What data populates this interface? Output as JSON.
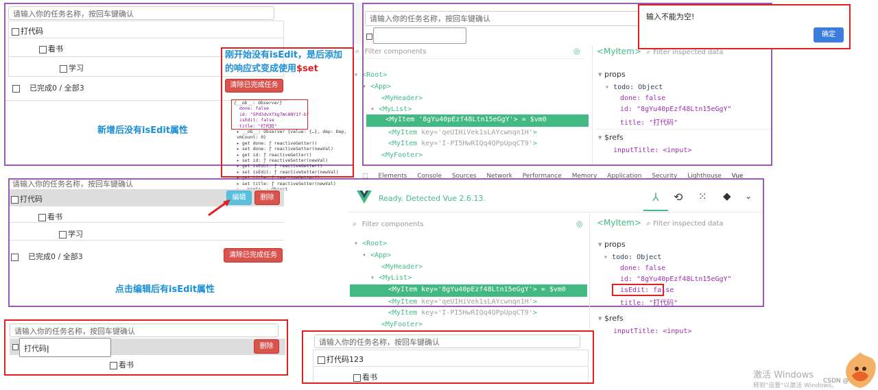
{
  "p1": {
    "input_placeholder": "请输入你的任务名称，按回车键确认",
    "items": [
      "打代码",
      "看书",
      "学习"
    ],
    "footer": "已完成0 / 全部3",
    "caption": "新增后没有isEdit属性"
  },
  "p2": {
    "note_line1": "刚开始没有isEdit，是后添加",
    "note_line2": "的响应式变成使用",
    "note_highlight": "$set",
    "clear_btn": "清除已完成任务",
    "console": [
      "{__ob__: Observer}",
      "done: false",
      "id: \"5Pd3dvXfXg7Wc8NY1f-b\"",
      "isEdit: false",
      "title: \"打代码\"",
      "▸ __ob__: Observer {value: {…}, dep: Dep, vmCount: 0}",
      "▸ get done: ƒ reactiveGetter()",
      "▸ set done: ƒ reactiveSetter(newVal)",
      "▸ get id: ƒ reactiveGetter()",
      "▸ set id: ƒ reactiveSetter(newVal)",
      "▸ get isEdit: ƒ reactiveGetter()",
      "▸ set isEdit: ƒ reactiveSetter(newVal)",
      "▸ get title: ƒ reactiveGetter()",
      "▸ set title: ƒ reactiveSetter(newVal)",
      "▸ __proto__: Object"
    ]
  },
  "p3": {
    "input_placeholder": "请输入你的任务名称，按回车键确认",
    "alert_text": "输入不能为空!",
    "alert_ok": "确定",
    "filter_placeholder": "Filter components",
    "filter_data_placeholder": "Filter inspected data",
    "selected_component": "<MyItem>",
    "tree": [
      "<Root>",
      "<App>",
      "<MyHeader>",
      "<MyList>",
      "<MyItem",
      "<MyItem",
      "<MyItem",
      "<MyFooter>"
    ],
    "keys": [
      "'8gYu40pEzf48Ltn15eGgY'",
      "'qeUIHiVek1sLAYcwnqn1H'",
      "'I-PI5HwRIQq4QPpUpqCT9'"
    ],
    "vm": "= $vm0",
    "props_title": "props",
    "todo_label": "todo: Object",
    "done": "done: false",
    "id": "id: \"8gYu40pEzf48Ltn15eGgY\"",
    "title": "title: \"打代码\"",
    "refs_title": "$refs",
    "input_title": "inputTitle: <input>"
  },
  "p4": {
    "input_placeholder": "请输入你的任务名称，按回车键确认",
    "items": [
      "打代码",
      "看书",
      "学习"
    ],
    "edit_btn": "编辑",
    "delete_btn": "删除",
    "footer": "已完成0 / 全部3",
    "clear_btn": "清除已完成任务",
    "caption": "点击编辑后有isEdit属性"
  },
  "p5": {
    "devtools_tabs": [
      "Elements",
      "Console",
      "Sources",
      "Network",
      "Performance",
      "Memory",
      "Application",
      "Security",
      "Lighthouse",
      "Vue"
    ],
    "status": "Ready. Detected Vue 2.6.13.",
    "filter_placeholder": "Filter components",
    "filter_data_placeholder": "Filter inspected data",
    "selected_component": "<MyItem>",
    "tree": [
      "<Root>",
      "<App>",
      "<MyHeader>",
      "<MyList>",
      "<MyItem",
      "<MyItem",
      "<MyItem",
      "<MyFooter>"
    ],
    "keys": [
      "'8gYu40pEzf48Ltn15eGgY'",
      "'qeUIHiVek1sLAYcwnqn1H'",
      "'I-PI5HwRIQq4QPpUpqCT9'"
    ],
    "vm": "= $vm0",
    "props_title": "props",
    "todo_label": "todo: Object",
    "done": "done: false",
    "id": "id: \"8gYu40pEzf48Ltn15eGgY\"",
    "isEdit": "isEdit: false",
    "title": "title: \"打代码\"",
    "refs_title": "$refs",
    "input_title": "inputTitle: <input>"
  },
  "p6": {
    "input_placeholder": "请输入你的任务名称，按回车键确认",
    "edit_value": "打代码",
    "delete_btn": "删除",
    "item2": "看书"
  },
  "p7": {
    "input_placeholder": "请输入你的任务名称，按回车键确认",
    "item1": "打代码123",
    "item2": "看书"
  },
  "watermark": {
    "line1": "激活 Windows",
    "line2": "转到\"设置\"以激活 Windows。",
    "csdn": "CSDN @"
  },
  "colors": {
    "vue_green": "#42b983",
    "purple": "#9b59b6",
    "red": "#e02020",
    "note_blue": "#1a8fd6"
  }
}
